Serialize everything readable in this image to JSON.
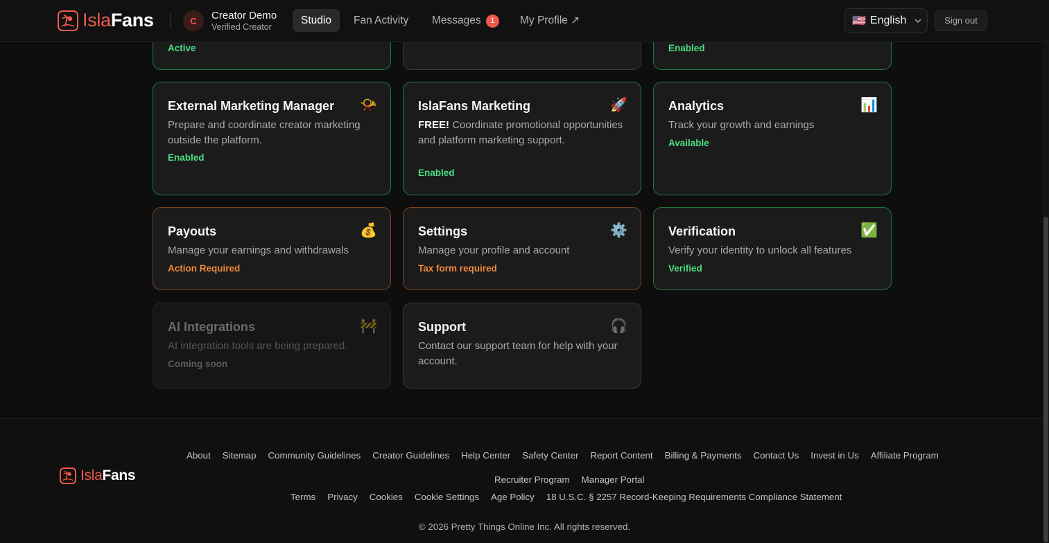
{
  "brand": {
    "isla": "Isla",
    "fans": "Fans",
    "icon": "island-palm-logo-icon",
    "color": "#ef5a4c"
  },
  "user": {
    "initial": "C",
    "name": "Creator Demo",
    "role": "Verified Creator"
  },
  "nav": [
    {
      "label": "Studio",
      "active": true
    },
    {
      "label": "Fan Activity"
    },
    {
      "label": "Messages",
      "badge": "1"
    },
    {
      "label": "My Profile ↗"
    }
  ],
  "language": {
    "flag": "🇺🇸",
    "label": "English",
    "icon": "chevron-down-icon"
  },
  "signout": "Sign out",
  "partial_cards": [
    {
      "status": "Active"
    },
    {
      "status": ""
    },
    {
      "status": "Enabled"
    }
  ],
  "cards": [
    {
      "title": "External Marketing Manager",
      "icon": "📯",
      "icon_name": "megaphone-icon",
      "desc": "Prepare and coordinate creator marketing outside the platform.",
      "status": "Enabled",
      "tone": "green"
    },
    {
      "title": "IslaFans Marketing",
      "icon": "🚀",
      "icon_name": "rocket-icon",
      "desc_strong": "FREE!",
      "desc": "Coordinate promotional opportunities and platform marketing support.",
      "status": "Enabled",
      "tone": "green"
    },
    {
      "title": "Analytics",
      "icon": "📊",
      "icon_name": "bar-chart-icon",
      "desc": "Track your growth and earnings",
      "status": "Available",
      "tone": "green"
    },
    {
      "title": "Payouts",
      "icon": "💰",
      "icon_name": "money-bag-icon",
      "desc": "Manage your earnings and withdrawals",
      "status": "Action Required",
      "tone": "orange"
    },
    {
      "title": "Settings",
      "icon": "⚙️",
      "icon_name": "gear-icon",
      "desc": "Manage your profile and account",
      "status": "Tax form required",
      "tone": "orange"
    },
    {
      "title": "Verification",
      "icon": "✅",
      "icon_name": "check-mark-icon",
      "desc": "Verify your identity to unlock all features",
      "status": "Verified",
      "tone": "green"
    },
    {
      "title": "AI Integrations",
      "icon": "🚧",
      "icon_name": "construction-icon",
      "desc": "AI integration tools are being prepared.",
      "status": "Coming soon",
      "tone": "gray"
    },
    {
      "title": "Support",
      "icon": "🎧",
      "icon_name": "headphones-icon",
      "desc": "Contact our support team for help with your account.",
      "status": "",
      "tone": "neutral"
    }
  ],
  "footer": {
    "links_row1": [
      "About",
      "Sitemap",
      "Community Guidelines",
      "Creator Guidelines",
      "Help Center",
      "Safety Center",
      "Report Content",
      "Billing & Payments",
      "Contact Us",
      "Invest in Us",
      "Affiliate Program"
    ],
    "links_row2": [
      "Recruiter Program",
      "Manager Portal"
    ],
    "links_row3": [
      "Terms",
      "Privacy",
      "Cookies",
      "Cookie Settings",
      "Age Policy",
      "18 U.S.C. § 2257 Record-Keeping Requirements Compliance Statement"
    ],
    "copyright": "© 2026 Pretty Things Online Inc. All rights reserved."
  },
  "colors": {
    "status_green": "#4ade80",
    "status_orange": "#f08a3a",
    "border_green": "#1f7a3d",
    "border_orange": "#7a4520"
  }
}
